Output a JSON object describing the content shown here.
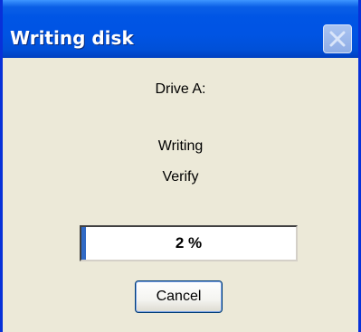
{
  "window": {
    "title": "Writing disk"
  },
  "dialog": {
    "drive_label": "Drive A:",
    "status_line_1": "Writing",
    "status_line_2": "Verify"
  },
  "progress": {
    "percent": 2,
    "label": "2 %"
  },
  "buttons": {
    "cancel_label": "Cancel",
    "close_icon": "close-icon"
  },
  "colors": {
    "titlebar": "#0054e3",
    "dialog_bg": "#ece9d8",
    "progress_fill": "#316ac5"
  }
}
